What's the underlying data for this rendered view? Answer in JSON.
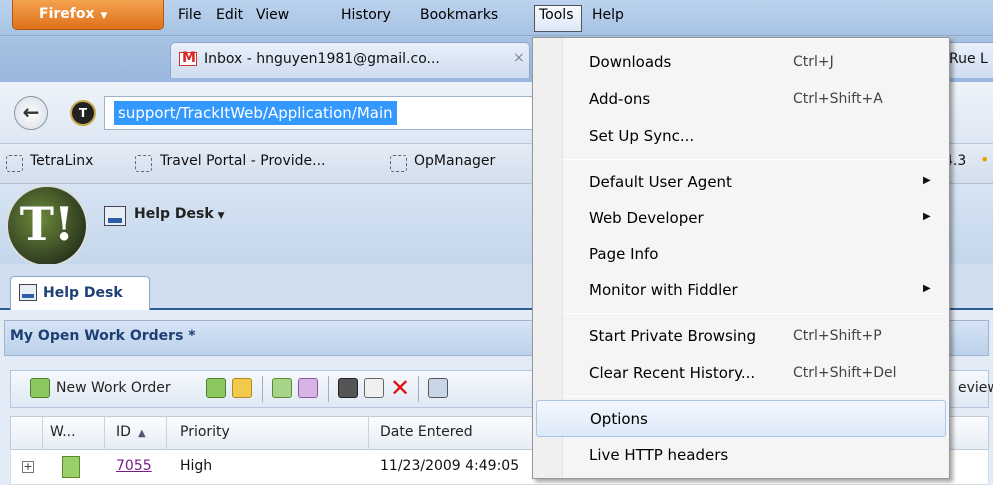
{
  "menubar": {
    "firefox_button": "Firefox",
    "items": [
      "File",
      "Edit",
      "View",
      "History",
      "Bookmarks",
      "Tools",
      "Help"
    ]
  },
  "tabs": [
    {
      "label": "Inbox - hnguyen1981@gmail.co...",
      "close": "×"
    },
    {
      "label": "Rue L"
    }
  ],
  "navbar": {
    "back_symbol": "←",
    "site_icon": "T",
    "url": "support/TrackItWeb/Application/Main"
  },
  "bookmarks": {
    "items": [
      "TetraLinx",
      "Travel Portal - Provide...",
      "OpManager"
    ],
    "right_text": "4.3"
  },
  "app": {
    "logo_text": "T!",
    "module_menu": "Help Desk",
    "tab_label": "Help Desk",
    "section_title": "My Open Work Orders *",
    "toolbar": {
      "new_work_order": "New Work Order",
      "preview": "eview"
    },
    "grid": {
      "headers": [
        "W...",
        "ID",
        "Priority",
        "Date Entered"
      ],
      "sort_indicator": "▲",
      "rows": [
        {
          "expander": "+",
          "id": "7055",
          "priority": "High",
          "date_entered": "11/23/2009 4:49:05"
        }
      ]
    }
  },
  "tools_menu": {
    "items": [
      {
        "label": "Downloads",
        "shortcut": "Ctrl+J"
      },
      {
        "label": "Add-ons",
        "shortcut": "Ctrl+Shift+A"
      },
      {
        "label": "Set Up Sync..."
      },
      {
        "label": "Default User Agent",
        "submenu": true
      },
      {
        "label": "Web Developer",
        "submenu": true
      },
      {
        "label": "Page Info"
      },
      {
        "label": "Monitor with Fiddler",
        "submenu": true
      },
      {
        "label": "Start Private Browsing",
        "shortcut": "Ctrl+Shift+P"
      },
      {
        "label": "Clear Recent History...",
        "shortcut": "Ctrl+Shift+Del"
      },
      {
        "label": "Options",
        "highlighted": true
      },
      {
        "label": "Live HTTP headers"
      }
    ],
    "submenu_arrow": "▶"
  }
}
